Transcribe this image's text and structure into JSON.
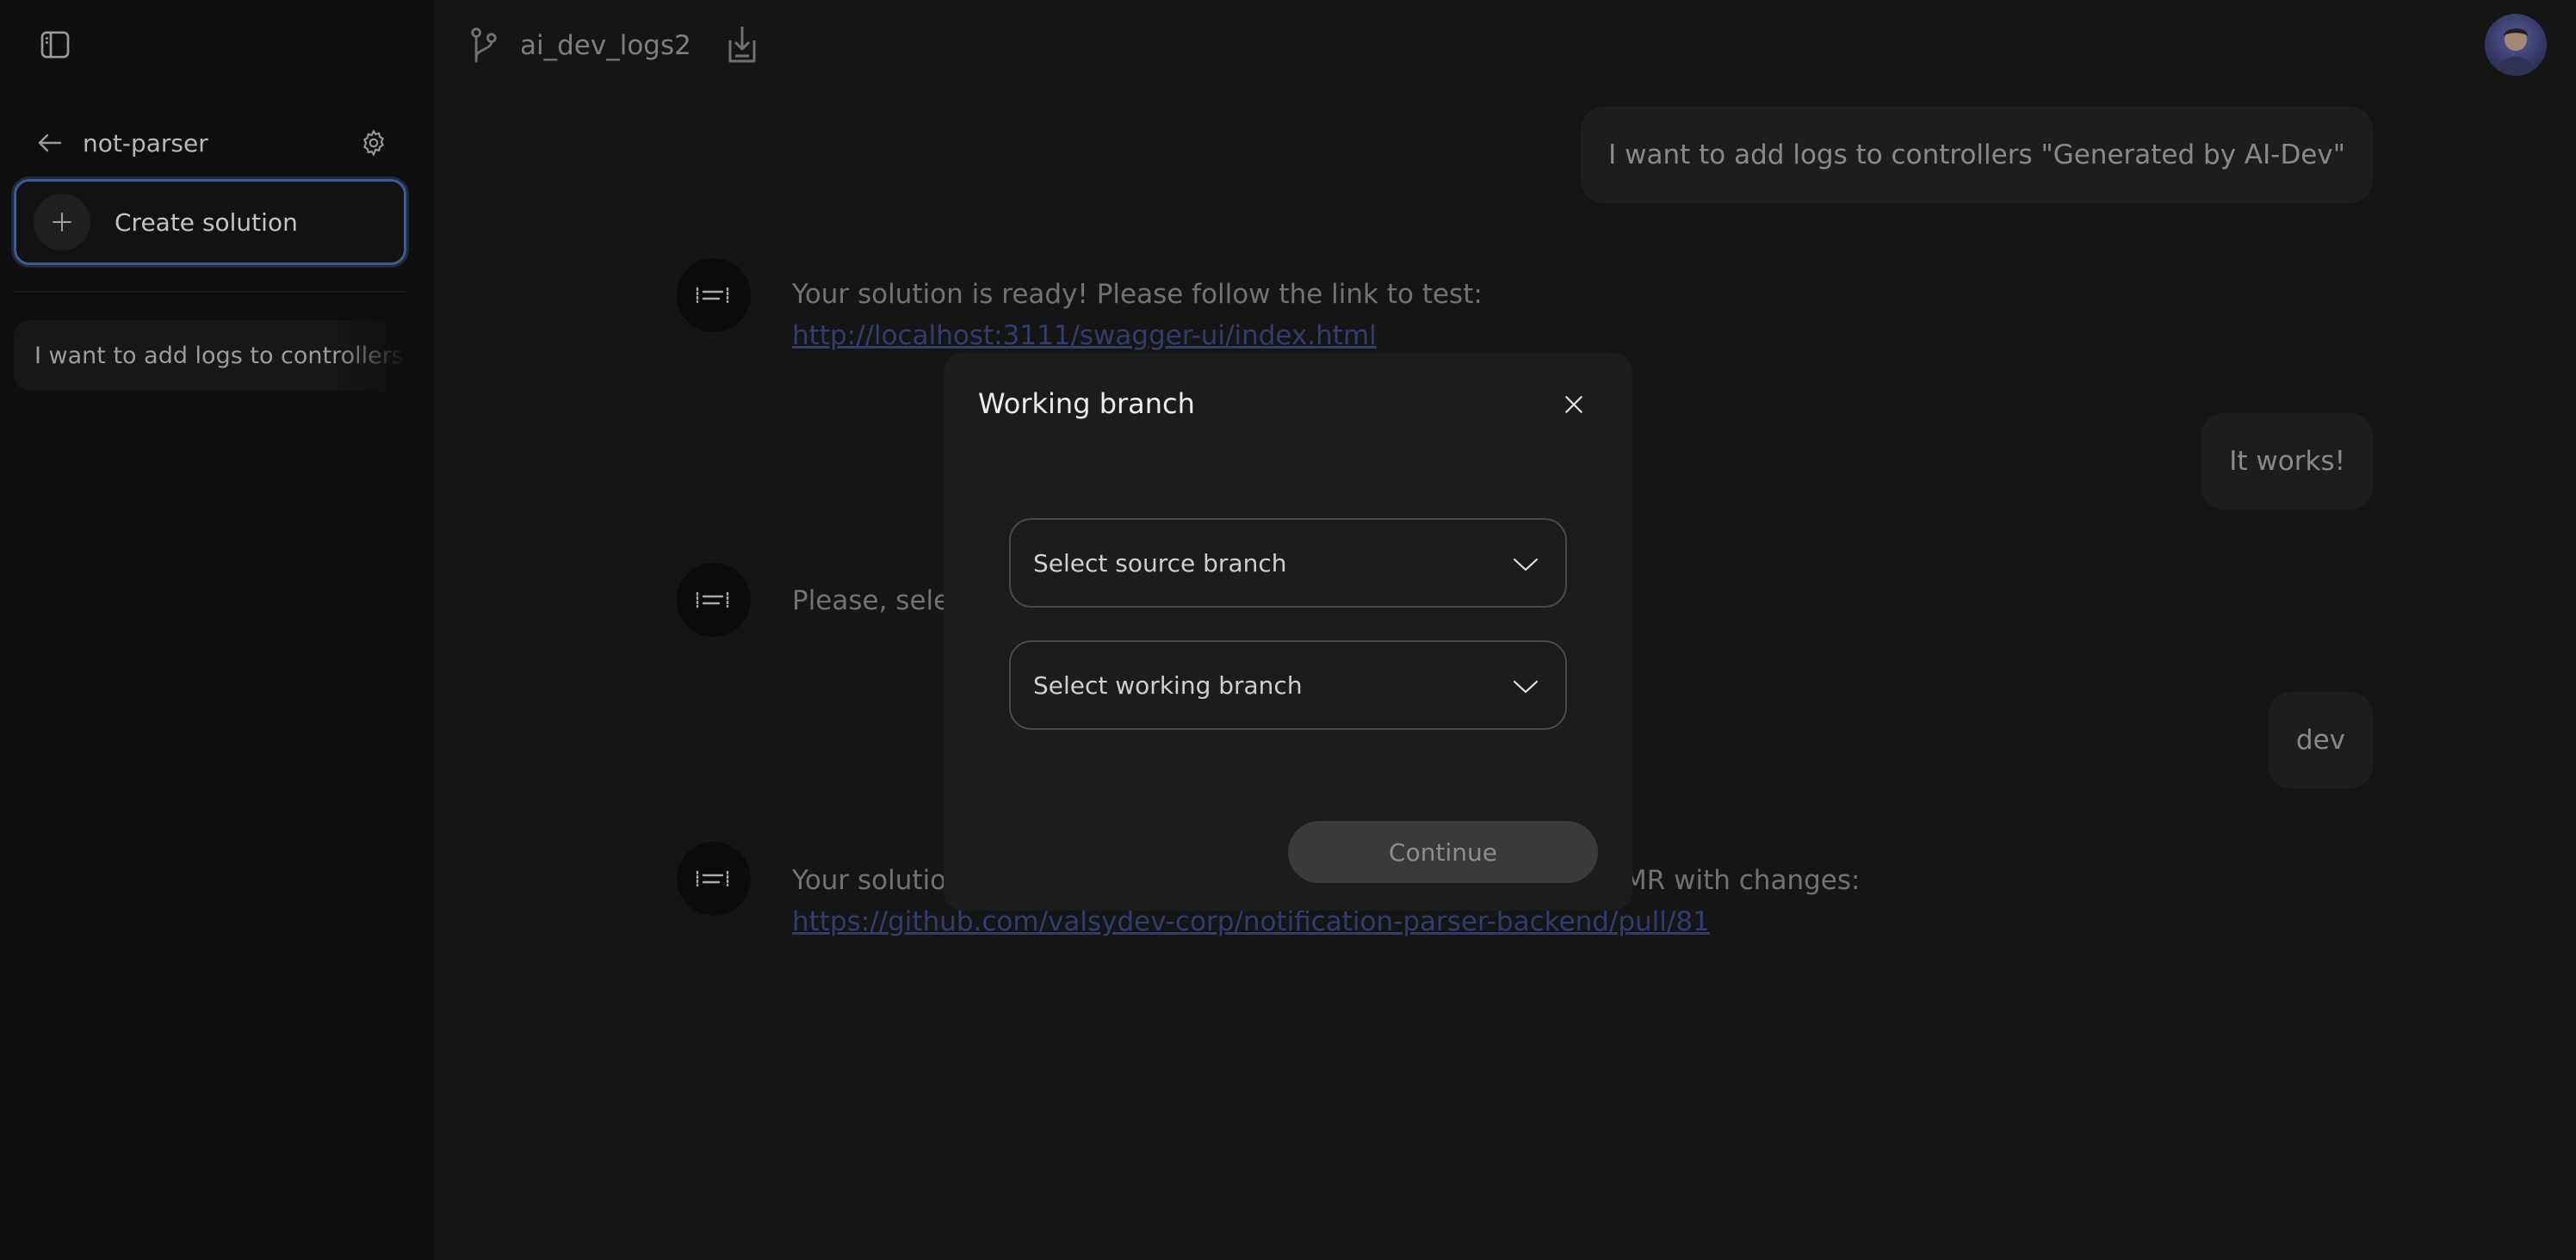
{
  "sidebar": {
    "project_name": "not-parser",
    "create_label": "Create solution",
    "history": [
      {
        "title": "I want to add logs to controllers \"Generated by AI-Dev\""
      }
    ]
  },
  "header": {
    "repo": "ai_dev_logs2"
  },
  "chat": {
    "messages": [
      {
        "role": "user",
        "text": "I want to add logs to controllers \"Generated by AI-Dev\""
      },
      {
        "role": "bot",
        "text": "Your solution is ready! Please follow the link to test: ",
        "link": "http://localhost:3111/swagger-ui/index.html"
      },
      {
        "role": "user",
        "text": "It works!"
      },
      {
        "role": "bot",
        "text": "Please, sele"
      },
      {
        "role": "user",
        "text": "dev"
      },
      {
        "role": "bot",
        "text_left": "Your solutio",
        "text_right": "MR with changes:",
        "link": "https://github.com/valsydev-corp/notification-parser-backend/pull/81"
      }
    ]
  },
  "modal": {
    "title": "Working branch",
    "source_placeholder": "Select source branch",
    "working_placeholder": "Select working branch",
    "continue_label": "Continue"
  },
  "colors": {
    "accent_border": "#3c5a94",
    "link": "#3e4a86",
    "sidebar_bg": "#0f0f0f",
    "main_bg": "#1a1a1a",
    "modal_bg": "#1c1c1c"
  }
}
